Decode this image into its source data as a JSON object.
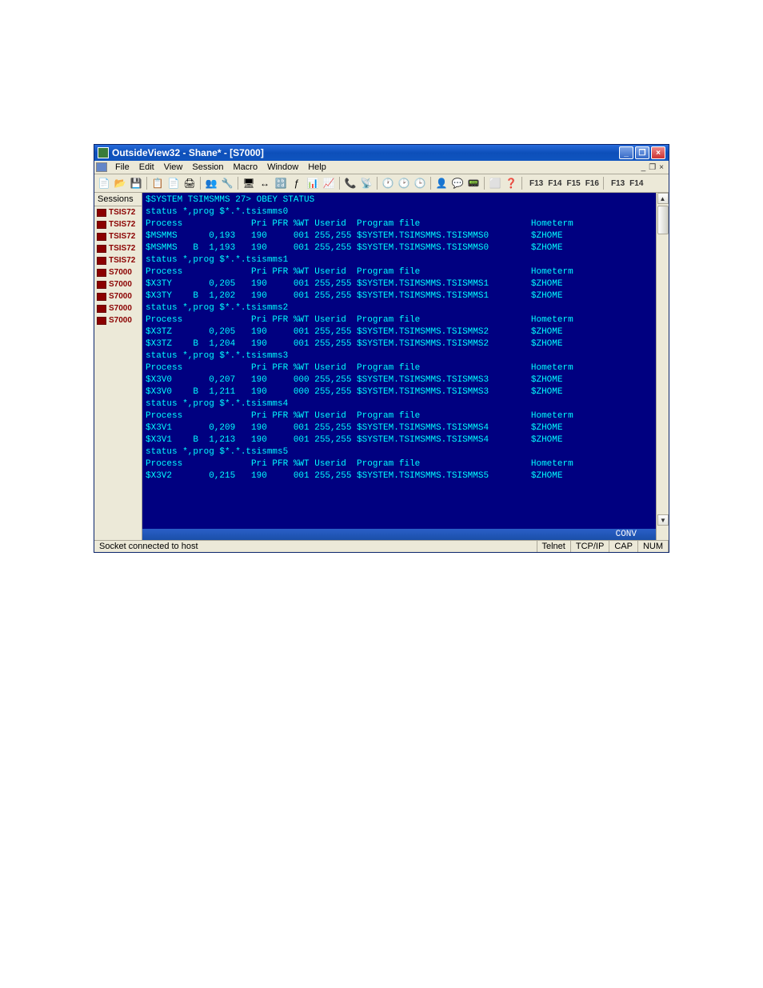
{
  "title": "OutsideView32 - Shane* - [S7000]",
  "menus": [
    "File",
    "Edit",
    "View",
    "Session",
    "Macro",
    "Window",
    "Help"
  ],
  "doc_controls": {
    "min": "_",
    "restore": "❐",
    "close": "×"
  },
  "toolbar_icons": [
    "📄",
    "📂",
    "💾",
    "📋",
    "📄",
    "🖨",
    "👥",
    "🔧",
    "🖥",
    "↔",
    "🔡",
    "ƒ",
    "📊",
    "📈",
    "📞",
    "📡",
    "🕐",
    "🕑",
    "🕒",
    "👤",
    "💬",
    "📟",
    "⬜",
    "❓"
  ],
  "fkeys1": [
    "F13",
    "F14",
    "F15",
    "F16"
  ],
  "fkeys2": [
    "F13",
    "F14"
  ],
  "sidebar": {
    "header": "Sessions",
    "items": [
      {
        "label": "TSIS72"
      },
      {
        "label": "TSIS72"
      },
      {
        "label": "TSIS72"
      },
      {
        "label": "TSIS72"
      },
      {
        "label": "TSIS72"
      },
      {
        "label": "S7000"
      },
      {
        "label": "S7000"
      },
      {
        "label": "S7000"
      },
      {
        "label": "S7000"
      },
      {
        "label": "S7000"
      }
    ]
  },
  "terminal_lines": [
    "$SYSTEM TSIMSMMS 27> OBEY STATUS",
    "status *,prog $*.*.tsismms0",
    "Process             Pri PFR %WT Userid  Program file                     Hometerm",
    "$MSMMS      0,193   190     001 255,255 $SYSTEM.TSIMSMMS.TSISMMS0        $ZHOME",
    "$MSMMS   B  1,193   190     001 255,255 $SYSTEM.TSIMSMMS.TSISMMS0        $ZHOME",
    "status *,prog $*.*.tsismms1",
    "Process             Pri PFR %WT Userid  Program file                     Hometerm",
    "$X3TY       0,205   190     001 255,255 $SYSTEM.TSIMSMMS.TSISMMS1        $ZHOME",
    "$X3TY    B  1,202   190     001 255,255 $SYSTEM.TSIMSMMS.TSISMMS1        $ZHOME",
    "status *,prog $*.*.tsismms2",
    "Process             Pri PFR %WT Userid  Program file                     Hometerm",
    "$X3TZ       0,205   190     001 255,255 $SYSTEM.TSIMSMMS.TSISMMS2        $ZHOME",
    "$X3TZ    B  1,204   190     001 255,255 $SYSTEM.TSIMSMMS.TSISMMS2        $ZHOME",
    "status *,prog $*.*.tsismms3",
    "Process             Pri PFR %WT Userid  Program file                     Hometerm",
    "$X3V0       0,207   190     000 255,255 $SYSTEM.TSIMSMMS.TSISMMS3        $ZHOME",
    "$X3V0    B  1,211   190     000 255,255 $SYSTEM.TSIMSMMS.TSISMMS3        $ZHOME",
    "status *,prog $*.*.tsismms4",
    "Process             Pri PFR %WT Userid  Program file                     Hometerm",
    "$X3V1       0,209   190     001 255,255 $SYSTEM.TSIMSMMS.TSISMMS4        $ZHOME",
    "$X3V1    B  1,213   190     001 255,255 $SYSTEM.TSIMSMMS.TSISMMS4        $ZHOME",
    "status *,prog $*.*.tsismms5",
    "Process             Pri PFR %WT Userid  Program file                     Hometerm",
    "$X3V2       0,215   190     001 255,255 $SYSTEM.TSIMSMMS.TSISMMS5        $ZHOME"
  ],
  "info_bar": "CONV",
  "status": {
    "left": "Socket connected to host",
    "telnet": "Telnet",
    "proto": "TCP/IP",
    "caps": "CAP",
    "num": "NUM"
  }
}
